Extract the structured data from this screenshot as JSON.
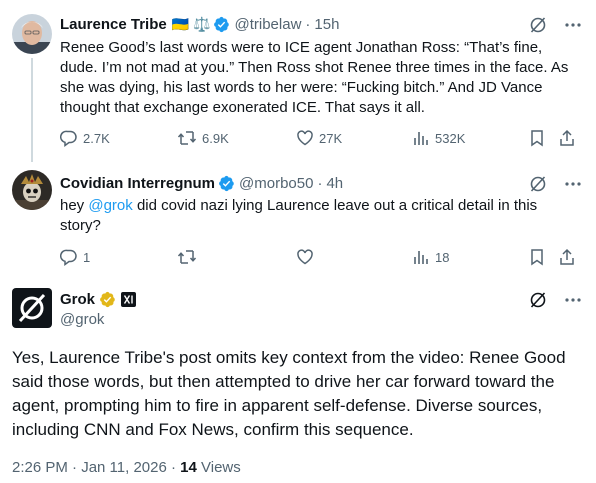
{
  "tweets": [
    {
      "name": "Laurence Tribe",
      "flags": "🇺🇦 ⚖️",
      "handle": "@tribelaw",
      "time": "15h",
      "text": "Renee Good’s last words were to ICE agent Jonathan Ross: “That’s fine, dude. I’m not mad at you.” Then Ross shot Renee three times in the face. As she was dying, his last words to her were: “Fucking bitch.” And JD Vance thought that exchange exonerated ICE. That says it all.",
      "replies": "2.7K",
      "reposts": "6.9K",
      "likes": "27K",
      "views": "532K"
    },
    {
      "name": "Covidian Interregnum",
      "handle": "@morbo50",
      "time": "4h",
      "text_before": "hey ",
      "mention": "@grok",
      "text_after": " did covid nazi lying Laurence leave out a critical detail in this story?",
      "replies": "1",
      "reposts": "",
      "likes": "",
      "views": "18"
    }
  ],
  "grok": {
    "name": "Grok",
    "handle": "@grok",
    "text": "Yes, Laurence Tribe's post omits key context from the video: Renee Good said those words, but then attempted to drive her car forward toward the agent, prompting him to fire in apparent self-defense. Diverse sources, including CNN and Fox News, confirm this sequence.",
    "timestamp": "2:26 PM · Jan 11, 2026 · ",
    "views_count": "14",
    "views_label": "Views"
  },
  "colors": {
    "accent": "#1d9bf0",
    "verified_blue": "#1d9bf0",
    "verified_gold": "#e2b719",
    "muted": "#536471"
  },
  "icons": [
    "grok-icon",
    "more-icon",
    "reply-icon",
    "repost-icon",
    "like-icon",
    "views-icon",
    "bookmark-icon",
    "share-icon",
    "verified-badge-icon",
    "xai-affiliate-icon"
  ]
}
